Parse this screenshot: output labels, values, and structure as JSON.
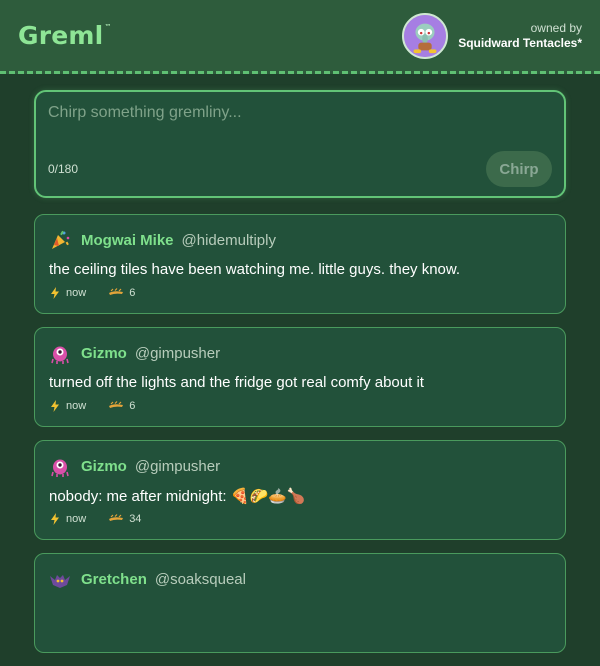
{
  "header": {
    "logo": "Greml",
    "logo_mark": "™",
    "owned_by_label": "owned by",
    "owner_name": "Squidward Tentacles*"
  },
  "composer": {
    "placeholder": "Chirp something gremliny...",
    "value": "",
    "counter": "0/180",
    "submit_label": "Chirp"
  },
  "posts": [
    {
      "avatar_icon": "party-popper-icon",
      "name": "Mogwai Mike",
      "handle": "@hidemultiply",
      "text": "the ceiling tiles have been watching me. little guys. they know.",
      "time": "now",
      "rechirps": "6"
    },
    {
      "avatar_icon": "pink-blob-creature-icon",
      "name": "Gizmo",
      "handle": "@gimpusher",
      "text": "turned off the lights and the fridge got real comfy about it",
      "time": "now",
      "rechirps": "6"
    },
    {
      "avatar_icon": "pink-blob-creature-icon",
      "name": "Gizmo",
      "handle": "@gimpusher",
      "text": "nobody: me after midnight: 🍕🌮🥧🍗",
      "time": "now",
      "rechirps": "34"
    },
    {
      "avatar_icon": "purple-bat-creature-icon",
      "name": "Gretchen",
      "handle": "@soaksqueal",
      "text": "",
      "time": "",
      "rechirps": ""
    }
  ]
}
